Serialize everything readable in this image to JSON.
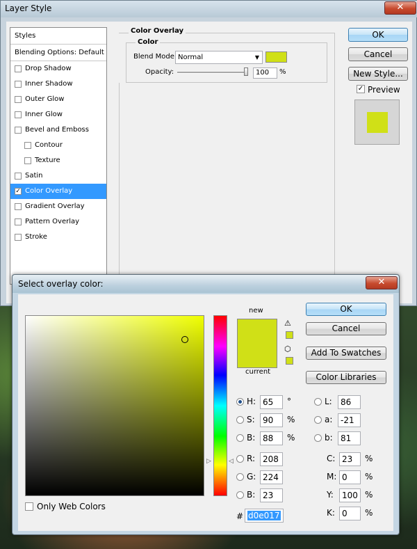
{
  "layer_style": {
    "title": "Layer Style",
    "close_glyph": "✕",
    "styles_header": "Styles",
    "blending_options": "Blending Options: Default",
    "items": [
      {
        "label": "Drop Shadow",
        "checked": false,
        "indent": false
      },
      {
        "label": "Inner Shadow",
        "checked": false,
        "indent": false
      },
      {
        "label": "Outer Glow",
        "checked": false,
        "indent": false
      },
      {
        "label": "Inner Glow",
        "checked": false,
        "indent": false
      },
      {
        "label": "Bevel and Emboss",
        "checked": false,
        "indent": false
      },
      {
        "label": "Contour",
        "checked": false,
        "indent": true
      },
      {
        "label": "Texture",
        "checked": false,
        "indent": true
      },
      {
        "label": "Satin",
        "checked": false,
        "indent": false
      },
      {
        "label": "Color Overlay",
        "checked": true,
        "indent": false,
        "selected": true
      },
      {
        "label": "Gradient Overlay",
        "checked": false,
        "indent": false
      },
      {
        "label": "Pattern Overlay",
        "checked": false,
        "indent": false
      },
      {
        "label": "Stroke",
        "checked": false,
        "indent": false
      }
    ],
    "section_title": "Color Overlay",
    "group_title": "Color",
    "blend_mode_label": "Blend Mode:",
    "blend_mode_value": "Normal",
    "opacity_label": "Opacity:",
    "opacity_value": "100",
    "opacity_unit": "%",
    "opacity_fraction": 1.0,
    "ok": "OK",
    "cancel": "Cancel",
    "new_style": "New Style...",
    "preview_label": "Preview",
    "preview_checked": true,
    "overlay_color": "#d0e017"
  },
  "picker": {
    "title": "Select overlay color:",
    "close_glyph": "✕",
    "new_label": "new",
    "current_label": "current",
    "new_color": "#d0e017",
    "current_color": "#d0e017",
    "ok": "OK",
    "cancel": "Cancel",
    "add_to_swatches": "Add To Swatches",
    "color_libraries": "Color Libraries",
    "only_web_colors": "Only Web Colors",
    "fields": {
      "H": {
        "label": "H:",
        "value": "65",
        "unit": "°"
      },
      "S": {
        "label": "S:",
        "value": "90",
        "unit": "%"
      },
      "B": {
        "label": "B:",
        "value": "88",
        "unit": "%"
      },
      "R": {
        "label": "R:",
        "value": "208",
        "unit": ""
      },
      "G": {
        "label": "G:",
        "value": "224",
        "unit": ""
      },
      "Bl": {
        "label": "B:",
        "value": "23",
        "unit": ""
      },
      "L": {
        "label": "L:",
        "value": "86",
        "unit": ""
      },
      "a": {
        "label": "a:",
        "value": "-21",
        "unit": ""
      },
      "b": {
        "label": "b:",
        "value": "81",
        "unit": ""
      },
      "C": {
        "label": "C:",
        "value": "23",
        "unit": "%"
      },
      "M": {
        "label": "M:",
        "value": "0",
        "unit": "%"
      },
      "Y": {
        "label": "Y:",
        "value": "100",
        "unit": "%"
      },
      "K": {
        "label": "K:",
        "value": "0",
        "unit": "%"
      }
    },
    "hex_label": "#",
    "hex_value": "d0e017",
    "hue_color": "#f0ff00"
  }
}
